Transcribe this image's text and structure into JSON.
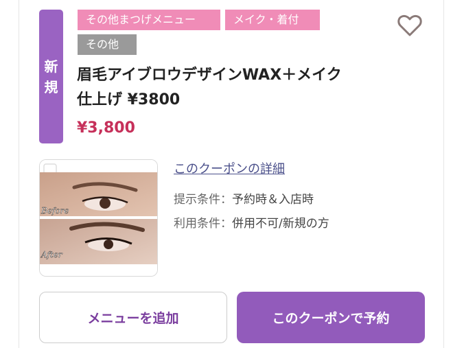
{
  "badge": {
    "line1": "新",
    "line2": "規"
  },
  "tags": [
    {
      "label": "その他まつげメニュー",
      "color": "#f08cb7"
    },
    {
      "label": "メイク・着付",
      "color": "#f08cb7"
    },
    {
      "label": "その他",
      "color": "#9a9a9a"
    }
  ],
  "favorite": {
    "icon": "heart-outline-icon"
  },
  "coupon": {
    "title_line1": "眉毛アイブロウデザインWAX＋メイク",
    "title_line2": "仕上げ ¥3800",
    "price": "¥3,800",
    "detail_link": "このクーポンの詳細",
    "conditions": [
      {
        "label": "提示条件：",
        "value": "予約時＆入店時"
      },
      {
        "label": "利用条件：",
        "value": "併用不可/新規の方"
      }
    ]
  },
  "photo": {
    "before_label": "Before",
    "after_label": "After"
  },
  "buttons": {
    "add_menu": "メニューを追加",
    "reserve": "このクーポンで予約"
  },
  "colors": {
    "accent": "#925bbb",
    "price": "#c6305a",
    "tag_pink": "#f08cb7",
    "tag_gray": "#9a9a9a"
  }
}
